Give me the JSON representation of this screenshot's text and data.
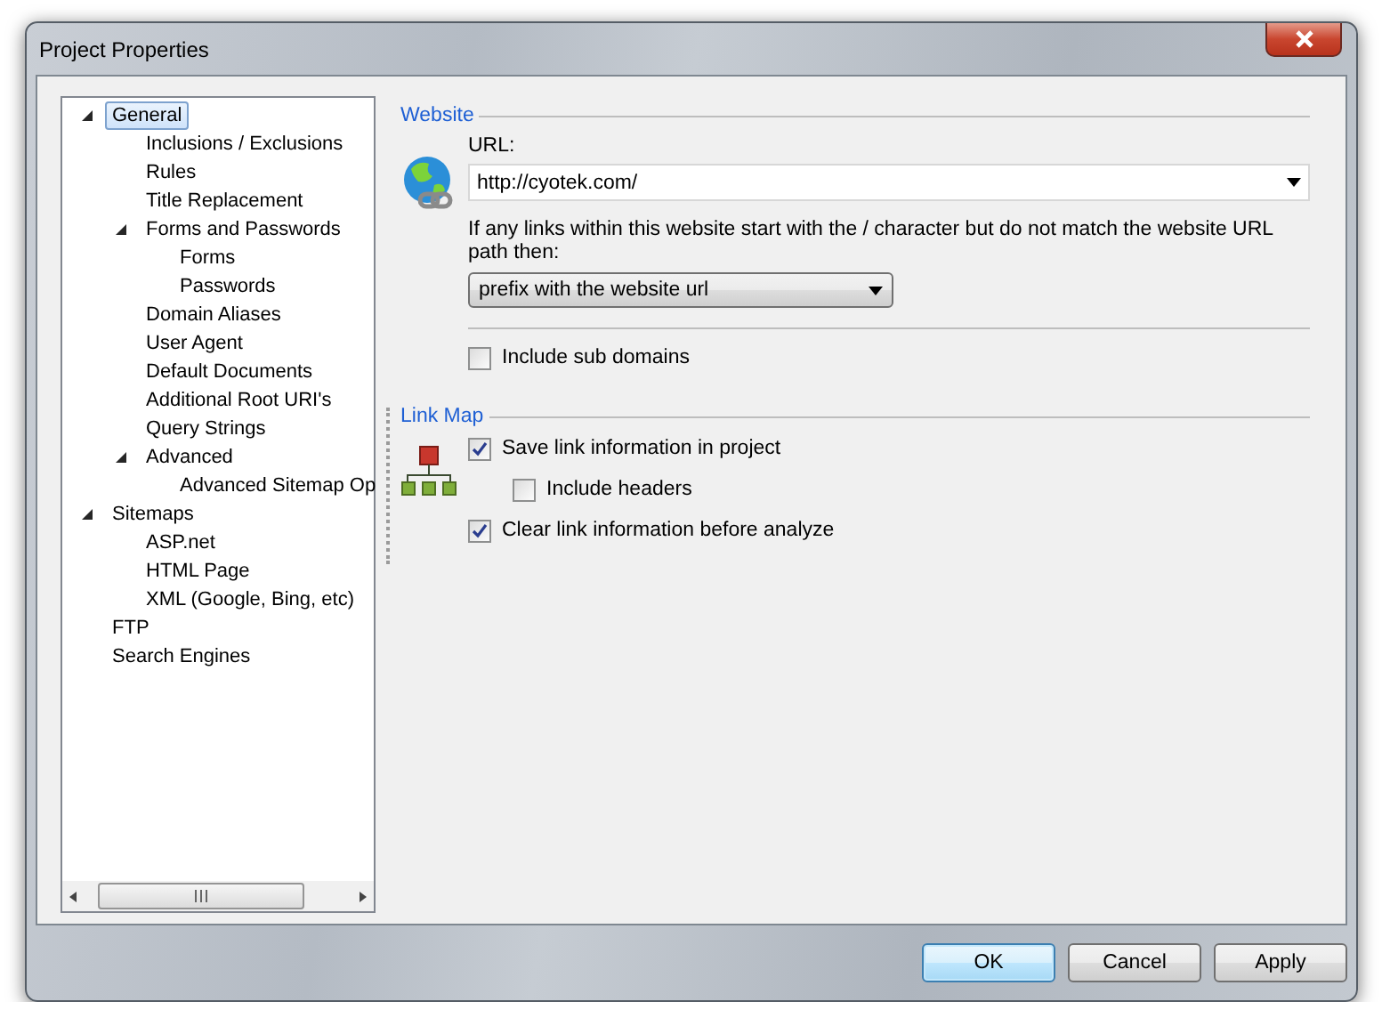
{
  "window": {
    "title": "Project Properties"
  },
  "tree": [
    {
      "label": "General",
      "selected": true,
      "expanded": true,
      "children": [
        {
          "label": "Inclusions / Exclusions",
          "selected": false
        },
        {
          "label": "Rules",
          "selected": false
        },
        {
          "label": "Title Replacement",
          "selected": false
        },
        {
          "label": "Forms and Passwords",
          "selected": false,
          "expanded": true,
          "children": [
            {
              "label": "Forms",
              "selected": false
            },
            {
              "label": "Passwords",
              "selected": false
            }
          ]
        },
        {
          "label": "Domain Aliases",
          "selected": false
        },
        {
          "label": "User Agent",
          "selected": false
        },
        {
          "label": "Default Documents",
          "selected": false
        },
        {
          "label": "Additional Root URI's",
          "selected": false
        },
        {
          "label": "Query Strings",
          "selected": false
        },
        {
          "label": "Advanced",
          "selected": false,
          "expanded": true,
          "children": [
            {
              "label": "Advanced Sitemap Op",
              "selected": false
            }
          ]
        }
      ]
    },
    {
      "label": "Sitemaps",
      "selected": false,
      "expanded": true,
      "children": [
        {
          "label": "ASP.net",
          "selected": false
        },
        {
          "label": "HTML Page",
          "selected": false
        },
        {
          "label": "XML (Google, Bing, etc)",
          "selected": false
        }
      ]
    },
    {
      "label": "FTP",
      "selected": false
    },
    {
      "label": "Search Engines",
      "selected": false
    }
  ],
  "website": {
    "heading": "Website",
    "url_label": "URL:",
    "url": "http://cyotek.com/",
    "note": "If any links within this website start with the / character but do not match the website URL path then:",
    "action": "prefix with the website url",
    "options": [
      {
        "label": "Include sub domains",
        "checked": false
      }
    ]
  },
  "link_map": {
    "heading": "Link Map",
    "options": [
      {
        "label": "Save link information in project",
        "checked": true,
        "children": [
          {
            "label": "Include headers",
            "checked": false
          }
        ]
      },
      {
        "label": "Clear link information before analyze",
        "checked": true
      }
    ]
  },
  "buttons": [
    {
      "label": "OK",
      "default": true
    },
    {
      "label": "Cancel",
      "default": false
    },
    {
      "label": "Apply",
      "default": false
    }
  ]
}
